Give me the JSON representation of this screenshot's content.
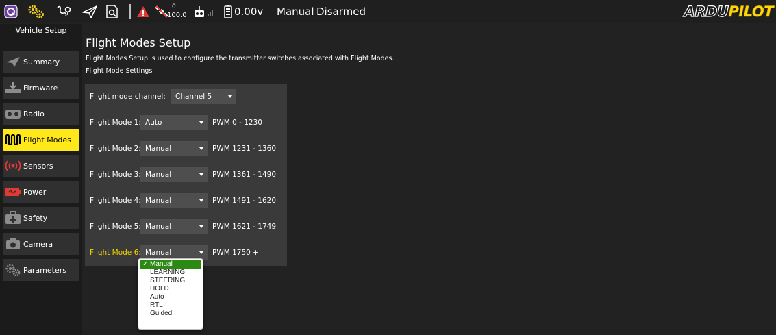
{
  "toolbar": {
    "gps_count": "0",
    "gps_hdop": "100.0",
    "battery_voltage": "0.00v",
    "flight_mode": "Manual",
    "arm_status": "Disarmed",
    "logo_part1": "ARDU",
    "logo_part2": "PILOT"
  },
  "sidebar": {
    "title": "Vehicle Setup",
    "items": [
      {
        "label": "Summary"
      },
      {
        "label": "Firmware"
      },
      {
        "label": "Radio"
      },
      {
        "label": "Flight Modes"
      },
      {
        "label": "Sensors"
      },
      {
        "label": "Power"
      },
      {
        "label": "Safety"
      },
      {
        "label": "Camera"
      },
      {
        "label": "Parameters"
      }
    ]
  },
  "main": {
    "title": "Flight Modes Setup",
    "description": "Flight Modes Setup is used to configure the transmitter switches associated with Flight Modes.",
    "section_title": "Flight Mode Settings",
    "channel_label": "Flight mode channel:",
    "channel_value": "Channel 5",
    "modes": [
      {
        "label": "Flight Mode 1:",
        "value": "Auto",
        "pwm": "PWM 0 - 1230"
      },
      {
        "label": "Flight Mode 2:",
        "value": "Manual",
        "pwm": "PWM 1231 - 1360"
      },
      {
        "label": "Flight Mode 3:",
        "value": "Manual",
        "pwm": "PWM 1361 - 1490"
      },
      {
        "label": "Flight Mode 4:",
        "value": "Manual",
        "pwm": "PWM 1491 - 1620"
      },
      {
        "label": "Flight Mode 5:",
        "value": "Manual",
        "pwm": "PWM 1621 - 1749"
      },
      {
        "label": "Flight Mode 6:",
        "value": "Manual",
        "pwm": "PWM 1750 +"
      }
    ]
  },
  "dropdown": {
    "checkmark": "✓",
    "options": [
      "Manual",
      "LEARNING",
      "STEERING",
      "HOLD",
      "Auto",
      "RTL",
      "Guided"
    ],
    "selected": "Manual"
  },
  "colors": {
    "background": "#222222",
    "panel": "#3a3a3a",
    "active_nav": "#ffe81a",
    "active_label": "#f0d400",
    "selected_option": "#2c8a12",
    "alert_red": "#e53935"
  },
  "icons": {
    "toolbar": [
      "qgc-logo-icon",
      "gear-cogs-icon",
      "plan-route-icon",
      "fly-paper-plane-icon",
      "log-analyze-icon",
      "warning-triangle-icon",
      "gps-satellite-icon",
      "rc-transmitter-icon",
      "signal-strength-icon",
      "battery-icon"
    ],
    "sidebar": [
      "summary-paper-plane-icon",
      "firmware-download-icon",
      "radio-transmitter-icon",
      "flight-modes-wave-icon",
      "sensors-radio-waves-icon",
      "power-battery-icon",
      "safety-kit-icon",
      "camera-icon",
      "parameters-gears-icon"
    ]
  }
}
